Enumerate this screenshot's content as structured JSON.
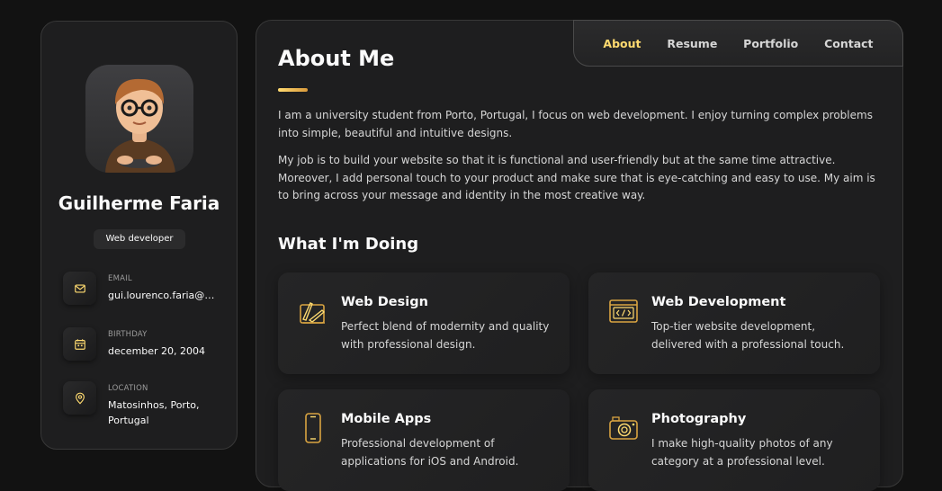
{
  "profile": {
    "name": "Guilherme Faria",
    "role": "Web developer"
  },
  "contacts": [
    {
      "title": "EMAIL",
      "value": "gui.lourenco.faria@gmail.com",
      "icon": "mail-icon"
    },
    {
      "title": "BIRTHDAY",
      "value": "december 20, 2004",
      "icon": "calendar-icon"
    },
    {
      "title": "LOCATION",
      "value": "Matosinhos, Porto, Portugal",
      "icon": "location-pin-icon"
    }
  ],
  "nav": {
    "items": [
      "About",
      "Resume",
      "Portfolio",
      "Contact"
    ],
    "active": "About"
  },
  "about": {
    "title": "About Me",
    "paragraphs": [
      "I am a university student from Porto, Portugal, I focus on web development. I enjoy turning complex problems into simple, beautiful and intuitive designs.",
      "My job is to build your website so that it is functional and user-friendly but at the same time attractive. Moreover, I add personal touch to your product and make sure that is eye-catching and easy to use. My aim is to bring across your message and identity in the most creative way."
    ]
  },
  "services": {
    "title": "What I'm Doing",
    "items": [
      {
        "title": "Web Design",
        "desc": "Perfect blend of modernity and quality with professional design.",
        "icon": "design-tools-icon"
      },
      {
        "title": "Web Development",
        "desc": "Top-tier website development, delivered with a professional touch.",
        "icon": "code-window-icon"
      },
      {
        "title": "Mobile Apps",
        "desc": "Professional development of applications for iOS and Android.",
        "icon": "smartphone-icon"
      },
      {
        "title": "Photography",
        "desc": "I make high-quality photos of any category at a professional level.",
        "icon": "camera-icon"
      }
    ]
  },
  "colors": {
    "accent": "#ffdb70",
    "background": "#121212",
    "panel": "#1e1e1f"
  }
}
